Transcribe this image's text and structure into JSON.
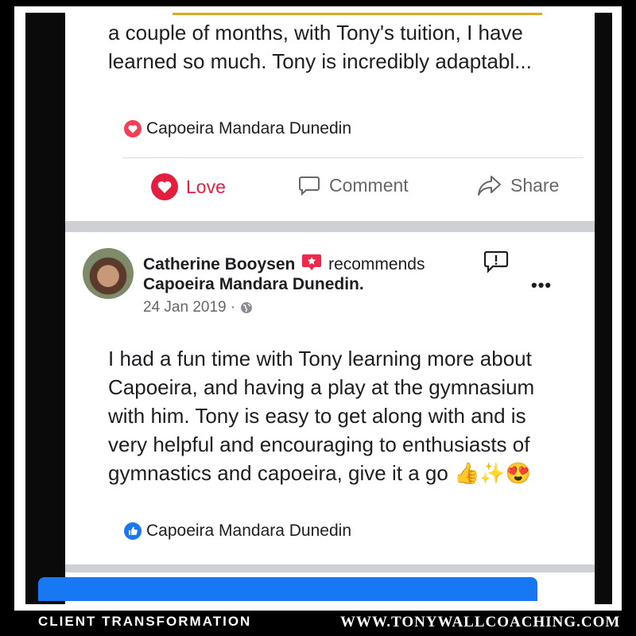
{
  "post1": {
    "text_lines": [
      "a couple of months, with Tony's tuition, I have",
      "learned so much. Tony is incredibly adaptabl..."
    ],
    "recommended_page": "Capoeira Mandara Dunedin",
    "actions": {
      "love": "Love",
      "comment": "Comment",
      "share": "Share"
    }
  },
  "post2": {
    "author": "Catherine Booysen",
    "verb": "recommends",
    "page": "Capoeira Mandara Dunedin.",
    "date": "24 Jan 2019 ·",
    "text_lines": [
      "I had a fun time with Tony learning more about",
      "Capoeira, and having a play at the gymnasium",
      "with him. Tony is easy to get along with and is",
      "very helpful and encouraging to enthusiasts of",
      "gymnastics and capoeira, give it a go 👍✨😍"
    ],
    "recommended_page": "Capoeira Mandara Dunedin",
    "more_label": "•••"
  },
  "footer": {
    "left": "CLIENT TRANSFORMATION",
    "right": "WWW.TONYWALLCOACHING.COM"
  },
  "colors": {
    "love": "#e41e3f",
    "like_blue": "#1877f2",
    "gold": "#e1a91c"
  },
  "icons": [
    "heart-icon",
    "comment-icon",
    "share-icon",
    "recommend-badge-icon",
    "report-icon",
    "globe-icon",
    "thumbs-up-icon"
  ]
}
